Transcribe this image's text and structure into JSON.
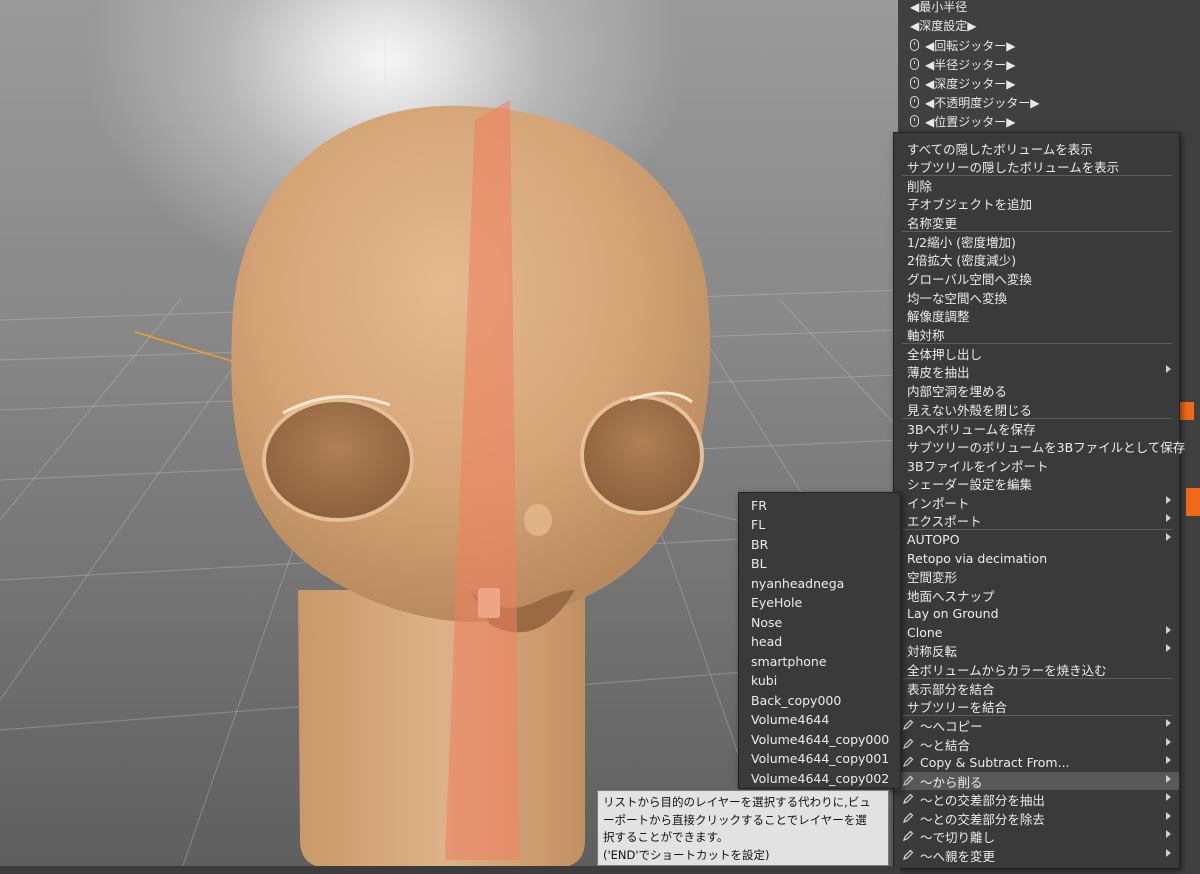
{
  "panel": {
    "rows": [
      {
        "label": "◀最小半径",
        "mouse": false
      },
      {
        "label": "◀深度設定▶",
        "mouse": false
      },
      {
        "label": "◀回転ジッター▶",
        "mouse": true
      },
      {
        "label": "◀半径ジッター▶",
        "mouse": true
      },
      {
        "label": "◀深度ジッター▶",
        "mouse": true
      },
      {
        "label": "◀不透明度ジッター▶",
        "mouse": true
      },
      {
        "label": "◀位置ジッター▶",
        "mouse": true
      }
    ]
  },
  "context_menu": {
    "items": [
      {
        "label": "すべての隠したボリュームを表示",
        "submenu": false,
        "pen": false
      },
      {
        "label": "サブツリーの隠したボリュームを表示",
        "submenu": false,
        "pen": false
      },
      {
        "label": "削除",
        "submenu": false,
        "pen": false
      },
      {
        "label": "子オブジェクトを追加",
        "submenu": false,
        "pen": false
      },
      {
        "label": "名称変更",
        "submenu": false,
        "pen": false
      },
      {
        "label": "1/2縮小 (密度増加)",
        "submenu": false,
        "pen": false
      },
      {
        "label": "2倍拡大 (密度減少)",
        "submenu": false,
        "pen": false
      },
      {
        "label": "グローバル空間へ変換",
        "submenu": false,
        "pen": false
      },
      {
        "label": "均一な空間へ変換",
        "submenu": false,
        "pen": false
      },
      {
        "label": "解像度調整",
        "submenu": false,
        "pen": false
      },
      {
        "label": "軸対称",
        "submenu": false,
        "pen": false
      },
      {
        "label": "全体押し出し",
        "submenu": false,
        "pen": false
      },
      {
        "label": "薄皮を抽出",
        "submenu": true,
        "pen": false
      },
      {
        "label": "内部空洞を埋める",
        "submenu": false,
        "pen": false
      },
      {
        "label": "見えない外殻を閉じる",
        "submenu": false,
        "pen": false
      },
      {
        "label": "3Bへボリュームを保存",
        "submenu": false,
        "pen": false
      },
      {
        "label": "サブツリーのボリュームを3Bファイルとして保存",
        "submenu": false,
        "pen": false
      },
      {
        "label": "3Bファイルをインポート",
        "submenu": false,
        "pen": false
      },
      {
        "label": "シェーダー設定を編集",
        "submenu": false,
        "pen": false
      },
      {
        "label": "インポート",
        "submenu": true,
        "pen": false
      },
      {
        "label": "エクスポート",
        "submenu": true,
        "pen": false
      },
      {
        "label": "AUTOPO",
        "submenu": true,
        "pen": false
      },
      {
        "label": "Retopo via decimation",
        "submenu": false,
        "pen": false
      },
      {
        "label": "空間変形",
        "submenu": false,
        "pen": false
      },
      {
        "label": "地面へスナップ",
        "submenu": false,
        "pen": false
      },
      {
        "label": "Lay on Ground",
        "submenu": false,
        "pen": false
      },
      {
        "label": "Clone",
        "submenu": true,
        "pen": false
      },
      {
        "label": "対称反転",
        "submenu": true,
        "pen": false
      },
      {
        "label": "全ボリュームからカラーを焼き込む",
        "submenu": false,
        "pen": false
      },
      {
        "label": "表示部分を結合",
        "submenu": false,
        "pen": false
      },
      {
        "label": "サブツリーを結合",
        "submenu": false,
        "pen": false
      },
      {
        "label": "～へコピー",
        "submenu": true,
        "pen": true
      },
      {
        "label": "～と結合",
        "submenu": true,
        "pen": true
      },
      {
        "label": "Copy & Subtract From...",
        "submenu": true,
        "pen": true
      },
      {
        "label": "～から削る",
        "submenu": true,
        "pen": true,
        "highlight": true
      },
      {
        "label": "～との交差部分を抽出",
        "submenu": true,
        "pen": true
      },
      {
        "label": "～との交差部分を除去",
        "submenu": true,
        "pen": true
      },
      {
        "label": "～で切り離し",
        "submenu": true,
        "pen": true
      },
      {
        "label": "～へ親を変更",
        "submenu": true,
        "pen": true
      }
    ]
  },
  "submenu": {
    "items": [
      "FR",
      "FL",
      "BR",
      "BL",
      "nyanheadnega",
      "EyeHole",
      "Nose",
      "head",
      "smartphone",
      "kubi",
      "Back_copy000",
      "Volume4644",
      "Volume4644_copy000",
      "Volume4644_copy001",
      "Volume4644_copy002"
    ]
  },
  "tooltip": {
    "lines": [
      "リストから目的のレイヤーを選択する代わりに,ビュ",
      "ーポートから直接クリックすることでレイヤーを選",
      "択することができます。",
      "('END'でショートカットを設定)"
    ]
  },
  "colors": {
    "skin": "#d9aa7e",
    "menu_bg": "#3a3a3a",
    "highlight": "#585858",
    "accent": "#f06a1a"
  }
}
